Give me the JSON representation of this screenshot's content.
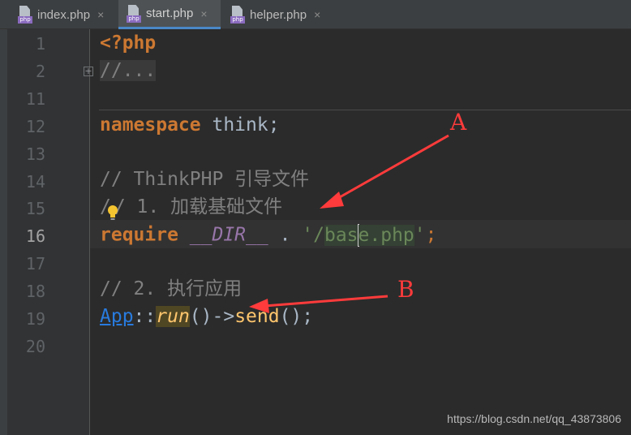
{
  "tabs": [
    {
      "name": "index.php",
      "badge": "php",
      "close": "×"
    },
    {
      "name": "start.php",
      "badge": "php",
      "close": "×",
      "active": true
    },
    {
      "name": "helper.php",
      "badge": "php",
      "close": "×"
    }
  ],
  "line_numbers": [
    "1",
    "2",
    "11",
    "12",
    "13",
    "14",
    "15",
    "16",
    "17",
    "18",
    "19",
    "20"
  ],
  "current_line": "16",
  "fold_toggle": "+",
  "code": {
    "l1": "<?php",
    "l2": "//...",
    "l12_kw": "namespace",
    "l12_ns": " think;",
    "l14": "// ThinkPHP 引导文件",
    "l15_a": "/",
    "l15_b": "/ 1. 加载基础文件",
    "l16_kw": "require",
    "l16_magic": "__DIR__",
    "l16_dot": " . ",
    "l16_q1": "'/",
    "l16_s1": "bas",
    "l16_s2": "e.php",
    "l16_q2": "'",
    "l16_semi": ";",
    "l18": "// 2. 执行应用",
    "l19_cls": "App",
    "l19_sep": "::",
    "l19_fn": "run",
    "l19_mid": "()->",
    "l19_fn2": "send",
    "l19_end": "();"
  },
  "annotations": {
    "a": "A",
    "b": "B"
  },
  "watermark": "https://blog.csdn.net/qq_43873806",
  "colors": {
    "annotation": "#ff3b3b",
    "keyword": "#cc7832",
    "comment": "#808080",
    "string": "#6a8759"
  }
}
